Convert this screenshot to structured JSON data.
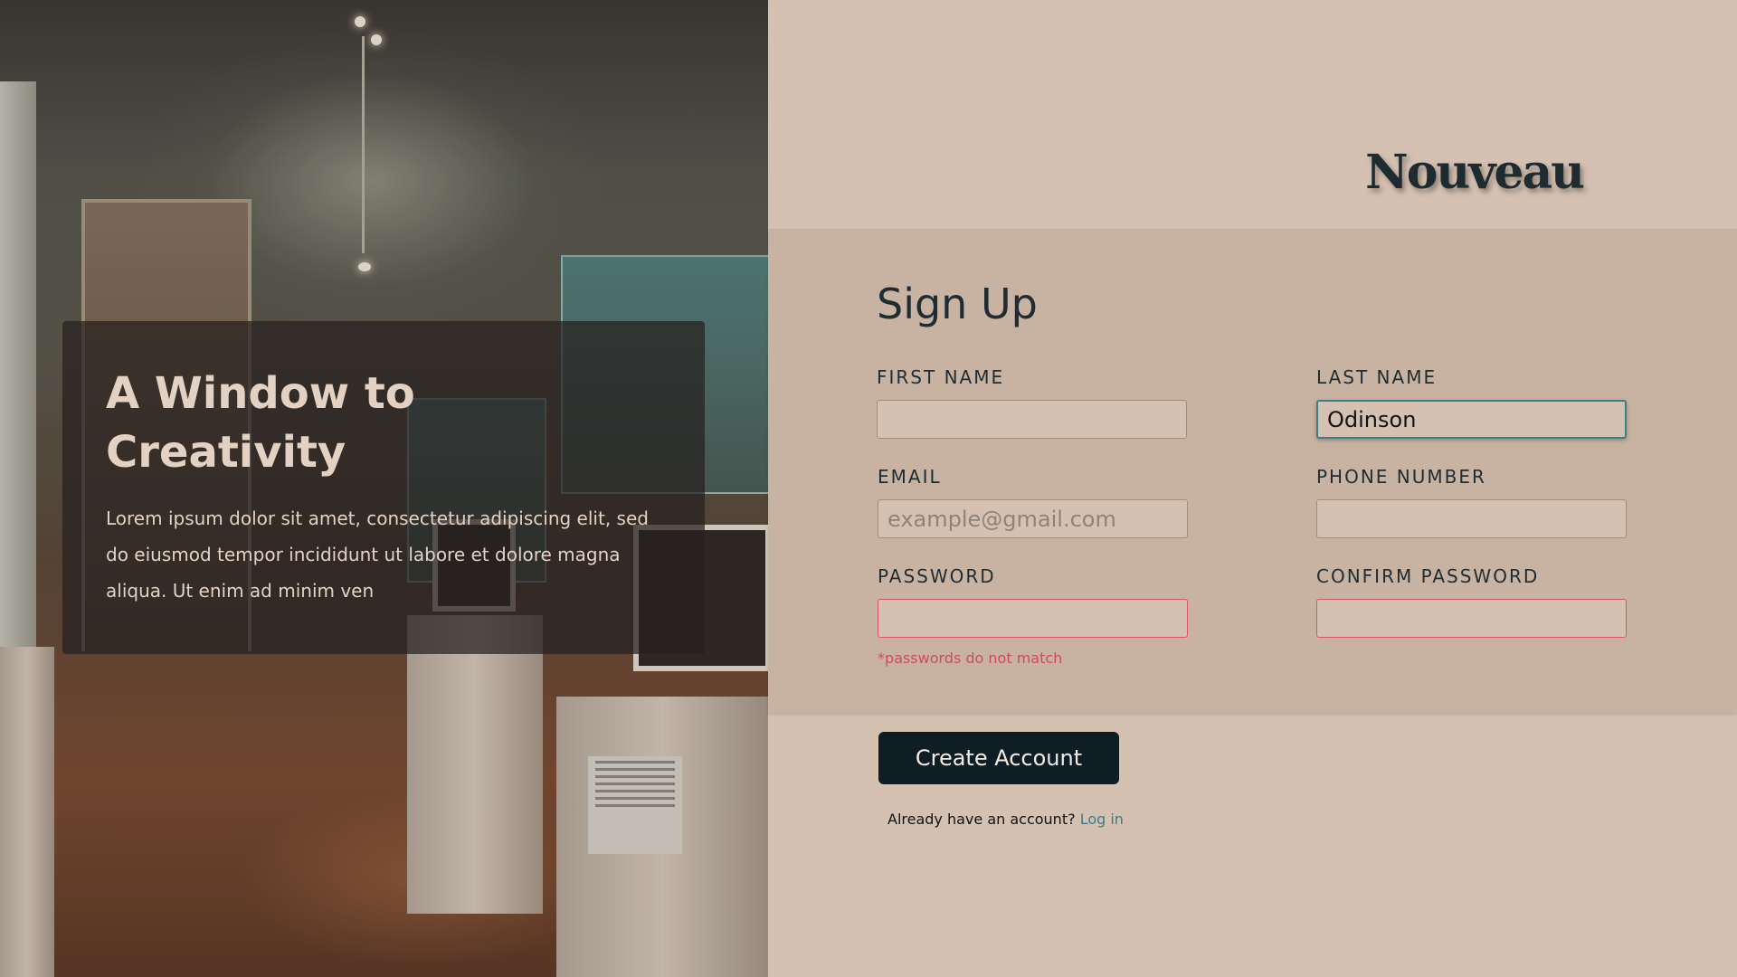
{
  "hero": {
    "title": "A Window to Creativity",
    "body": "Lorem ipsum dolor sit amet, consectetur adipiscing elit, sed do eiusmod tempor incididunt ut labore et dolore magna aliqua. Ut enim ad minim ven"
  },
  "brand": {
    "name": "Nouveau"
  },
  "form": {
    "title": "Sign Up",
    "first_name": {
      "label": "FIRST NAME",
      "value": "",
      "placeholder": ""
    },
    "last_name": {
      "label": "LAST NAME",
      "value": "Odinson",
      "placeholder": ""
    },
    "email": {
      "label": "EMAIL",
      "value": "",
      "placeholder": "example@gmail.com"
    },
    "phone": {
      "label": "PHONE NUMBER",
      "value": "",
      "placeholder": ""
    },
    "password": {
      "label": "PASSWORD",
      "value": "",
      "placeholder": ""
    },
    "confirm_password": {
      "label": "CONFIRM PASSWORD",
      "value": "",
      "placeholder": ""
    },
    "error": "*passwords do not match",
    "submit_label": "Create Account",
    "login_prompt": "Already have an account?",
    "login_link": "Log in"
  },
  "colors": {
    "panel_bg": "#d5c1b1",
    "form_band": "#c8b3a2",
    "primary_button": "#0f1e24",
    "error": "#cf4a61",
    "focus": "#3e7e86",
    "link": "#3f7b83"
  }
}
